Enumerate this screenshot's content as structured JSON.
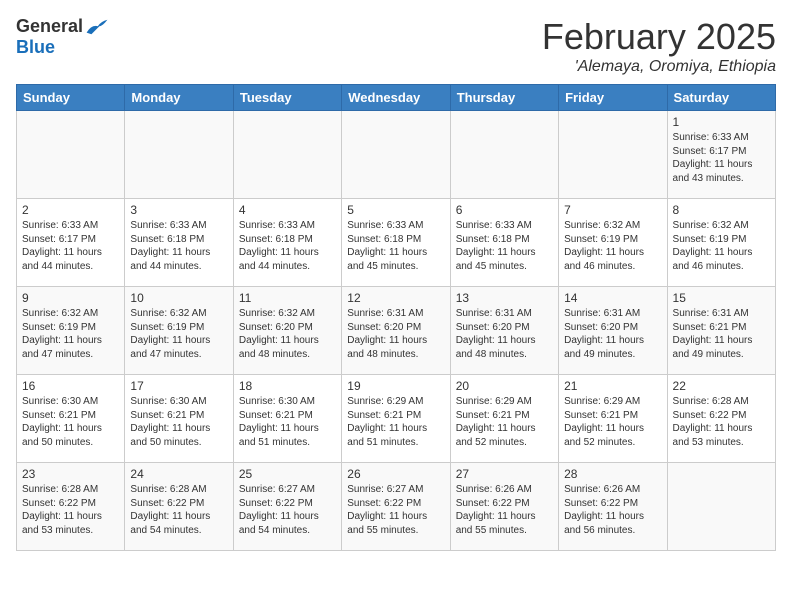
{
  "header": {
    "logo_general": "General",
    "logo_blue": "Blue",
    "month": "February 2025",
    "location": "'Alemaya, Oromiya, Ethiopia"
  },
  "weekdays": [
    "Sunday",
    "Monday",
    "Tuesday",
    "Wednesday",
    "Thursday",
    "Friday",
    "Saturday"
  ],
  "weeks": [
    [
      {
        "day": "",
        "info": ""
      },
      {
        "day": "",
        "info": ""
      },
      {
        "day": "",
        "info": ""
      },
      {
        "day": "",
        "info": ""
      },
      {
        "day": "",
        "info": ""
      },
      {
        "day": "",
        "info": ""
      },
      {
        "day": "1",
        "info": "Sunrise: 6:33 AM\nSunset: 6:17 PM\nDaylight: 11 hours\nand 43 minutes."
      }
    ],
    [
      {
        "day": "2",
        "info": "Sunrise: 6:33 AM\nSunset: 6:17 PM\nDaylight: 11 hours\nand 44 minutes."
      },
      {
        "day": "3",
        "info": "Sunrise: 6:33 AM\nSunset: 6:18 PM\nDaylight: 11 hours\nand 44 minutes."
      },
      {
        "day": "4",
        "info": "Sunrise: 6:33 AM\nSunset: 6:18 PM\nDaylight: 11 hours\nand 44 minutes."
      },
      {
        "day": "5",
        "info": "Sunrise: 6:33 AM\nSunset: 6:18 PM\nDaylight: 11 hours\nand 45 minutes."
      },
      {
        "day": "6",
        "info": "Sunrise: 6:33 AM\nSunset: 6:18 PM\nDaylight: 11 hours\nand 45 minutes."
      },
      {
        "day": "7",
        "info": "Sunrise: 6:32 AM\nSunset: 6:19 PM\nDaylight: 11 hours\nand 46 minutes."
      },
      {
        "day": "8",
        "info": "Sunrise: 6:32 AM\nSunset: 6:19 PM\nDaylight: 11 hours\nand 46 minutes."
      }
    ],
    [
      {
        "day": "9",
        "info": "Sunrise: 6:32 AM\nSunset: 6:19 PM\nDaylight: 11 hours\nand 47 minutes."
      },
      {
        "day": "10",
        "info": "Sunrise: 6:32 AM\nSunset: 6:19 PM\nDaylight: 11 hours\nand 47 minutes."
      },
      {
        "day": "11",
        "info": "Sunrise: 6:32 AM\nSunset: 6:20 PM\nDaylight: 11 hours\nand 48 minutes."
      },
      {
        "day": "12",
        "info": "Sunrise: 6:31 AM\nSunset: 6:20 PM\nDaylight: 11 hours\nand 48 minutes."
      },
      {
        "day": "13",
        "info": "Sunrise: 6:31 AM\nSunset: 6:20 PM\nDaylight: 11 hours\nand 48 minutes."
      },
      {
        "day": "14",
        "info": "Sunrise: 6:31 AM\nSunset: 6:20 PM\nDaylight: 11 hours\nand 49 minutes."
      },
      {
        "day": "15",
        "info": "Sunrise: 6:31 AM\nSunset: 6:21 PM\nDaylight: 11 hours\nand 49 minutes."
      }
    ],
    [
      {
        "day": "16",
        "info": "Sunrise: 6:30 AM\nSunset: 6:21 PM\nDaylight: 11 hours\nand 50 minutes."
      },
      {
        "day": "17",
        "info": "Sunrise: 6:30 AM\nSunset: 6:21 PM\nDaylight: 11 hours\nand 50 minutes."
      },
      {
        "day": "18",
        "info": "Sunrise: 6:30 AM\nSunset: 6:21 PM\nDaylight: 11 hours\nand 51 minutes."
      },
      {
        "day": "19",
        "info": "Sunrise: 6:29 AM\nSunset: 6:21 PM\nDaylight: 11 hours\nand 51 minutes."
      },
      {
        "day": "20",
        "info": "Sunrise: 6:29 AM\nSunset: 6:21 PM\nDaylight: 11 hours\nand 52 minutes."
      },
      {
        "day": "21",
        "info": "Sunrise: 6:29 AM\nSunset: 6:21 PM\nDaylight: 11 hours\nand 52 minutes."
      },
      {
        "day": "22",
        "info": "Sunrise: 6:28 AM\nSunset: 6:22 PM\nDaylight: 11 hours\nand 53 minutes."
      }
    ],
    [
      {
        "day": "23",
        "info": "Sunrise: 6:28 AM\nSunset: 6:22 PM\nDaylight: 11 hours\nand 53 minutes."
      },
      {
        "day": "24",
        "info": "Sunrise: 6:28 AM\nSunset: 6:22 PM\nDaylight: 11 hours\nand 54 minutes."
      },
      {
        "day": "25",
        "info": "Sunrise: 6:27 AM\nSunset: 6:22 PM\nDaylight: 11 hours\nand 54 minutes."
      },
      {
        "day": "26",
        "info": "Sunrise: 6:27 AM\nSunset: 6:22 PM\nDaylight: 11 hours\nand 55 minutes."
      },
      {
        "day": "27",
        "info": "Sunrise: 6:26 AM\nSunset: 6:22 PM\nDaylight: 11 hours\nand 55 minutes."
      },
      {
        "day": "28",
        "info": "Sunrise: 6:26 AM\nSunset: 6:22 PM\nDaylight: 11 hours\nand 56 minutes."
      },
      {
        "day": "",
        "info": ""
      }
    ]
  ]
}
